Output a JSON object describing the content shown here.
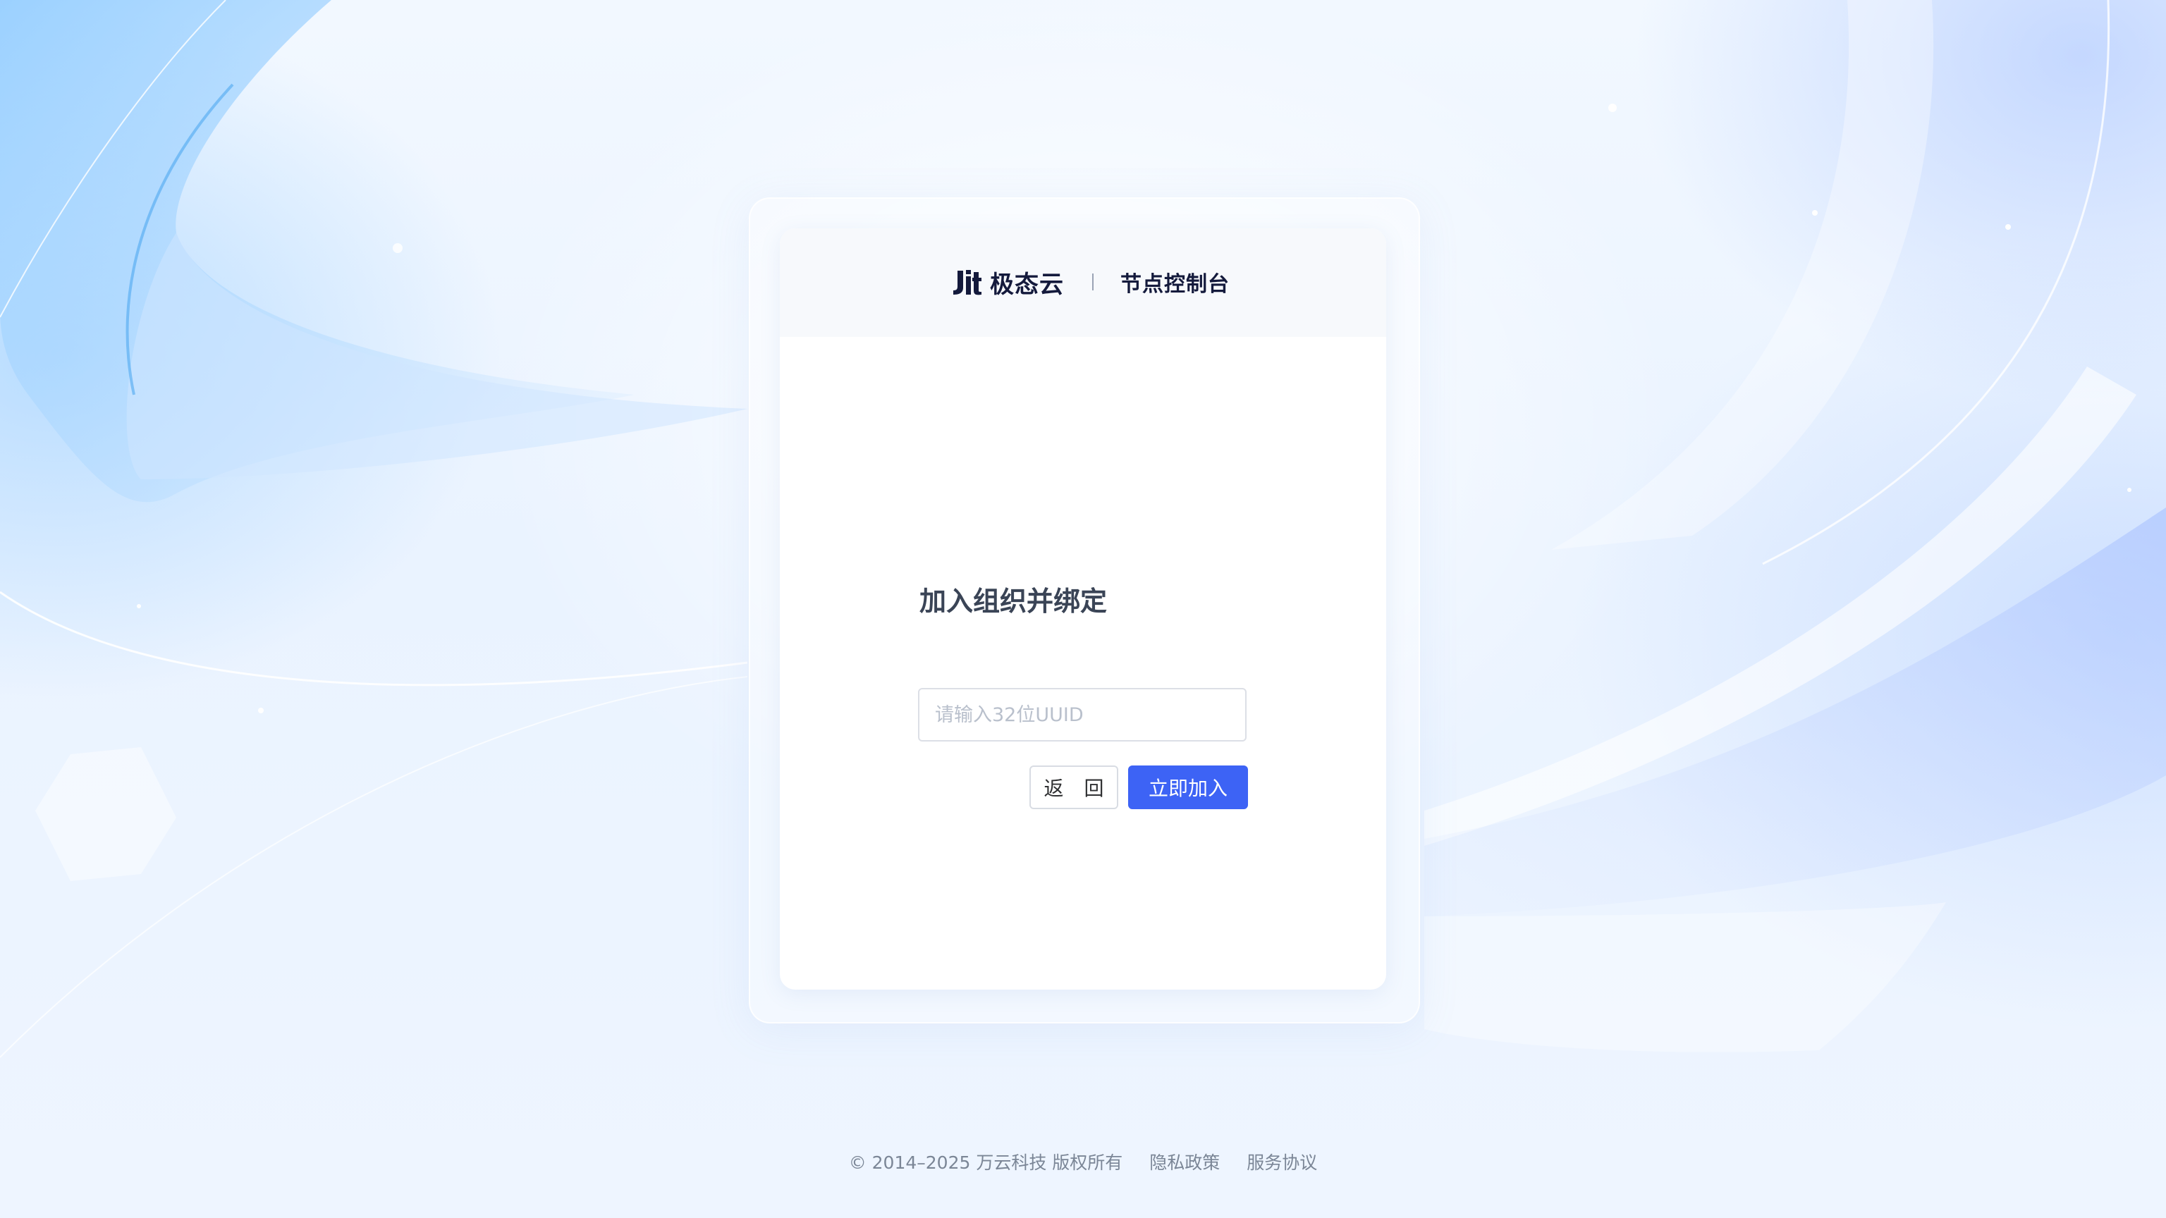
{
  "brand": {
    "logo_text": "极态云",
    "console_title": "节点控制台"
  },
  "form": {
    "title": "加入组织并绑定",
    "uuid_placeholder": "请输入32位UUID",
    "uuid_value": "",
    "back_label": "返 回",
    "join_label": "立即加入"
  },
  "footer": {
    "copyright": "© 2014–2025 万云科技 版权所有",
    "privacy_label": "隐私政策",
    "terms_label": "服务协议"
  },
  "colors": {
    "primary": "#3d63f5",
    "brand_dark": "#141a3c",
    "title_text": "#3a4456",
    "footer_text": "#7b8696"
  }
}
